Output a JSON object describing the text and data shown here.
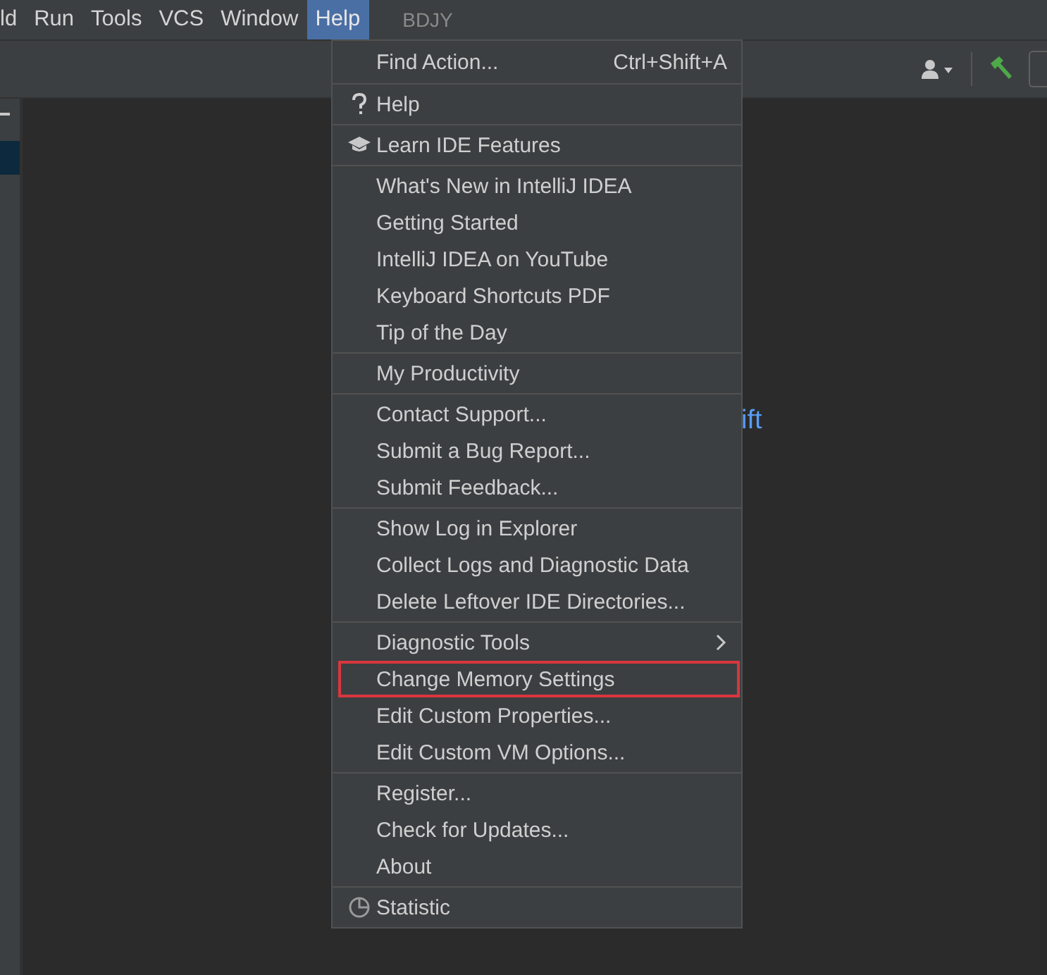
{
  "menubar": [
    {
      "label": "ld",
      "selected": false
    },
    {
      "label": "Run",
      "selected": false
    },
    {
      "label": "Tools",
      "selected": false
    },
    {
      "label": "VCS",
      "selected": false
    },
    {
      "label": "Window",
      "selected": false
    },
    {
      "label": "Help",
      "selected": true
    }
  ],
  "project_title": "BDJY",
  "editor": {
    "hint_fragment": "ift"
  },
  "help_menu": {
    "groups": [
      [
        {
          "label": "Find Action...",
          "shortcut": "Ctrl+Shift+A"
        }
      ],
      [
        {
          "label": "Help",
          "kind": "question"
        }
      ],
      [
        {
          "label": "Learn IDE Features",
          "kind": "cap"
        }
      ],
      [
        {
          "label": "What's New in IntelliJ IDEA"
        },
        {
          "label": "Getting Started"
        },
        {
          "label": "IntelliJ IDEA on YouTube"
        },
        {
          "label": "Keyboard Shortcuts PDF"
        },
        {
          "label": "Tip of the Day"
        }
      ],
      [
        {
          "label": "My Productivity"
        }
      ],
      [
        {
          "label": "Contact Support..."
        },
        {
          "label": "Submit a Bug Report..."
        },
        {
          "label": "Submit Feedback..."
        }
      ],
      [
        {
          "label": "Show Log in Explorer"
        },
        {
          "label": "Collect Logs and Diagnostic Data"
        },
        {
          "label": "Delete Leftover IDE Directories..."
        }
      ],
      [
        {
          "label": "Diagnostic Tools",
          "submenu": true
        },
        {
          "label": "Change Memory Settings",
          "outlined": true
        },
        {
          "label": "Edit Custom Properties..."
        },
        {
          "label": "Edit Custom VM Options..."
        }
      ],
      [
        {
          "label": "Register..."
        },
        {
          "label": "Check for Updates..."
        },
        {
          "label": "About"
        }
      ],
      [
        {
          "label": "Statistic",
          "kind": "pie"
        }
      ]
    ]
  }
}
